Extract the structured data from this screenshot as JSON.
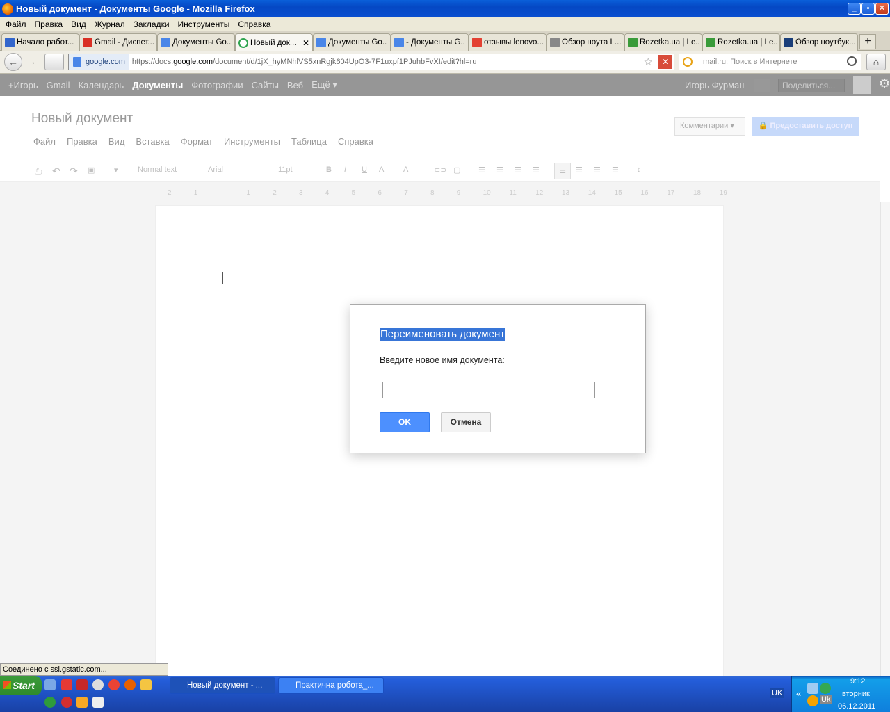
{
  "window": {
    "title": "Новый документ - Документы Google - Mozilla Firefox",
    "buttons": [
      "_",
      "▫",
      "✕"
    ]
  },
  "menubar": [
    "Файл",
    "Правка",
    "Вид",
    "Журнал",
    "Закладки",
    "Инструменты",
    "Справка"
  ],
  "tabs": [
    {
      "label": "Начало работ...",
      "icon_color": "#3366cc",
      "active": false
    },
    {
      "label": "Gmail - Диспет...",
      "icon_color": "#d93025",
      "active": false
    },
    {
      "label": "Документы Go...",
      "icon_color": "#4a86e8",
      "active": false
    },
    {
      "label": "Новый док...",
      "icon_color": "#2ea44f",
      "active": true
    },
    {
      "label": "Документы Go...",
      "icon_color": "#4a86e8",
      "active": false
    },
    {
      "label": "- Документы G...",
      "icon_color": "#4a86e8",
      "active": false
    },
    {
      "label": "отзывы lenovo...",
      "icon_color": "#e34133",
      "active": false
    },
    {
      "label": "Обзор ноута L...",
      "icon_color": "#888888",
      "active": false
    },
    {
      "label": "Rozetka.ua | Le...",
      "icon_color": "#3a9b3a",
      "active": false
    },
    {
      "label": "Rozetka.ua | Le...",
      "icon_color": "#3a9b3a",
      "active": false
    },
    {
      "label": "Обзор ноутбук...",
      "icon_color": "#1a3e79",
      "active": false
    }
  ],
  "tab_close": "✕",
  "new_tab": "+",
  "nav": {
    "back": "←",
    "forward": "→",
    "site": "google.com",
    "url_prefix": "https://docs.",
    "url_host": "google.com",
    "url_rest": "/document/d/1jX_hyMNhlVS5xnRgjk604UpO3-7F1uxpf1PJuhbFvXI/edit?hl=ru",
    "search_placeholder": "mail.ru: Поиск в Интернете"
  },
  "gbar": {
    "items": [
      "+Игорь",
      "Gmail",
      "Календарь",
      "Документы",
      "Фотографии",
      "Сайты",
      "Веб",
      "Ещё ▾"
    ],
    "active": "Документы",
    "user": "Игорь Фурман",
    "share_label": "Поделиться..."
  },
  "doc": {
    "title": "Новый документ",
    "menu": [
      "Файл",
      "Правка",
      "Вид",
      "Вставка",
      "Формат",
      "Инструменты",
      "Таблица",
      "Справка"
    ],
    "comments_label": "Комментарии ▾",
    "share_label": "Предоставить доступ",
    "style_select": "Normal text",
    "font_select": "Arial",
    "size_select": "11pt",
    "ruler_ticks": [
      "2",
      "1",
      "",
      "1",
      "2",
      "3",
      "4",
      "5",
      "6",
      "7",
      "8",
      "9",
      "10",
      "11",
      "12",
      "13",
      "14",
      "15",
      "16",
      "17",
      "18",
      "19"
    ]
  },
  "dialog": {
    "title": "Переименовать документ",
    "prompt": "Введите новое имя документа:",
    "input_value": "",
    "ok_label": "OK",
    "cancel_label": "Отмена"
  },
  "status_text": "Соединено с ssl.gstatic.com...",
  "taskbar": {
    "start_label": "Start",
    "items": [
      {
        "label": "Новый документ - ...",
        "active": true
      },
      {
        "label": "Практична робота_...",
        "active": false
      }
    ],
    "lang": "UK",
    "lang2": "Uk",
    "time": "9:12",
    "day": "вторник",
    "date": "06.12.2011"
  }
}
